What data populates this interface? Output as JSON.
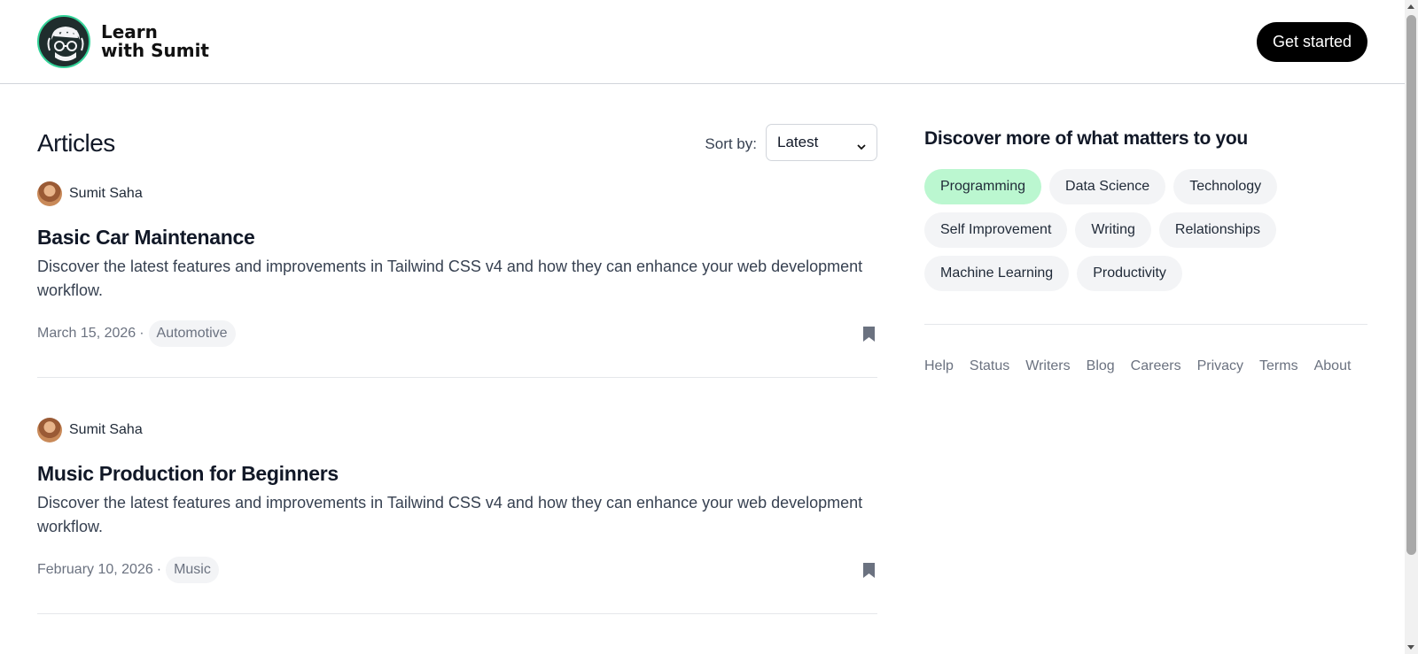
{
  "header": {
    "brand_line1": "Learn",
    "brand_line2": "with Sumit",
    "cta_label": "Get started"
  },
  "main": {
    "title": "Articles",
    "sort_label": "Sort by:",
    "sort_value": "Latest",
    "articles": [
      {
        "author": "Sumit Saha",
        "title": "Basic Car Maintenance",
        "description": "Discover the latest features and improvements in Tailwind CSS v4 and how they can enhance your web development workflow.",
        "date": "March 15, 2026",
        "separator": "·",
        "tag": "Automotive"
      },
      {
        "author": "Sumit Saha",
        "title": "Music Production for Beginners",
        "description": "Discover the latest features and improvements in Tailwind CSS v4 and how they can enhance your web development workflow.",
        "date": "February 10, 2026",
        "separator": "·",
        "tag": "Music"
      }
    ]
  },
  "sidebar": {
    "title": "Discover more of what matters to you",
    "topics": [
      "Programming",
      "Data Science",
      "Technology",
      "Self Improvement",
      "Writing",
      "Relationships",
      "Machine Learning",
      "Productivity"
    ],
    "active_topic": "Programming",
    "footer_links": [
      "Help",
      "Status",
      "Writers",
      "Blog",
      "Careers",
      "Privacy",
      "Terms",
      "About"
    ]
  },
  "colors": {
    "accent": "#34d399",
    "active_topic_bg": "#bbf7d0",
    "cta_bg": "#000000"
  },
  "icons": {
    "logo": "learn-with-sumit-logo",
    "avatar": "author-avatar",
    "bookmark": "bookmark-icon",
    "select": "chevron-down-icon"
  }
}
